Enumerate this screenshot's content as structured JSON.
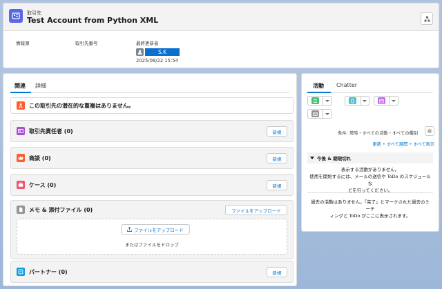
{
  "header": {
    "object_label": "取引先",
    "record_name": "Test Account from Python XML",
    "fields": [
      {
        "label": "情報源",
        "value": ""
      },
      {
        "label": "取引先番号",
        "value": ""
      },
      {
        "label": "最終更新者",
        "user": "S.K",
        "timestamp": "2025/08/22 15:54"
      }
    ]
  },
  "left": {
    "tabs": [
      "関連",
      "詳細"
    ],
    "duplicate_message": "この取引先の潜在的な重複はありません。",
    "cards": [
      {
        "title": "取引先責任者 (0)",
        "button": "新規",
        "icon_color": "#a94fd3"
      },
      {
        "title": "商談 (0)",
        "button": "新規",
        "icon_color": "#ff5d2d"
      },
      {
        "title": "ケース (0)",
        "button": "新規",
        "icon_color": "#f2536d"
      },
      {
        "title": "メモ & 添付ファイル (0)",
        "button": "ファイルをアップロード",
        "icon_color": "#969492"
      },
      {
        "title": "パートナー (0)",
        "button": "新規",
        "icon_color": "#0d9dda"
      }
    ],
    "upload": {
      "button": "ファイルをアップロード",
      "drop_text": "またはファイルをドロップ"
    }
  },
  "right": {
    "tabs": [
      "活動",
      "Chatter"
    ],
    "filter_text": "条件: 常時・すべての活動・すべての種別",
    "links": [
      "更新",
      "すべて展開",
      "すべて表示"
    ],
    "section_title": "今後 & 期限切れ",
    "empty_upcoming": [
      "表示する活動がありません。",
      "使用を開始するには、メールの送信や ToDo のスケジュールな",
      "どを行ってください。"
    ],
    "empty_past": [
      "過去の活動はありません。「完了」とマークされた過去のミーテ",
      "ィングと ToDo がここに表示されます。"
    ]
  },
  "colors": {
    "brand": "#0176d3",
    "account_icon": "#5867e8",
    "task_icon": "#4bc076",
    "call_icon": "#48c3cc",
    "event_icon": "#cb65ff",
    "email_icon": "#939393"
  }
}
